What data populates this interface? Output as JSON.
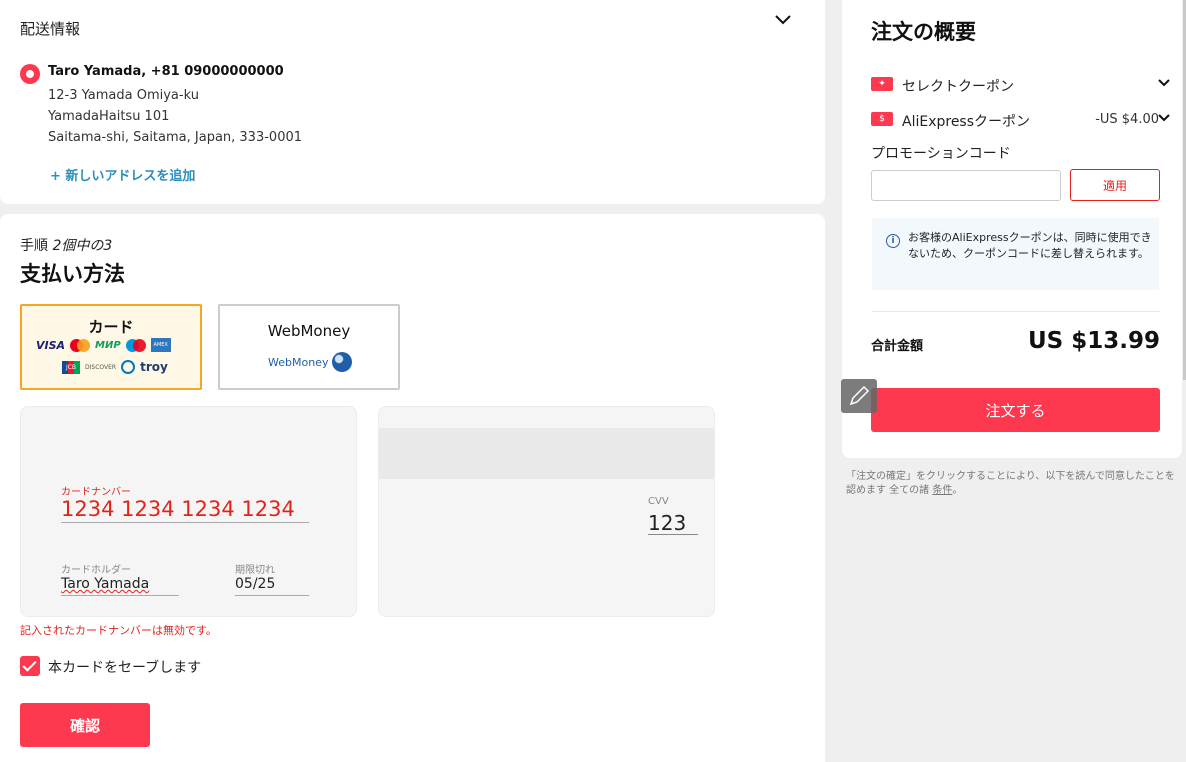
{
  "shipping": {
    "title": "配送情報",
    "name_phone": "Taro Yamada, +81 09000000000",
    "address": [
      "12-3 Yamada Omiya-ku",
      "YamadaHaitsu 101",
      "Saitama-shi, Saitama, Japan, 333-0001"
    ],
    "add_address": "+ 新しいアドレスを追加"
  },
  "payment": {
    "step_prefix": "手順",
    "step_mid": "2個中の",
    "step_num": "3",
    "title": "支払い方法",
    "methods": [
      {
        "label": "カード",
        "selected": true,
        "logos": [
          "VISA",
          "mastercard",
          "МИР",
          "maestro",
          "AMEX",
          "JCB",
          "DISCOVER",
          "Diners",
          "troy"
        ]
      },
      {
        "label": "WebMoney",
        "selected": false,
        "logo_text": "WebMoney"
      }
    ],
    "card": {
      "number_label": "カードナンバー",
      "number_value": "1234 1234 1234 1234",
      "holder_label": "カードホルダー",
      "holder_value": "Taro Yamada",
      "expiry_label": "期限切れ",
      "expiry_value": "05/25",
      "cvv_label": "CVV",
      "cvv_value": "123"
    },
    "error": "記入されたカードナンバーは無効です。",
    "save_card_label": "本カードをセーブします",
    "save_card_checked": true,
    "confirm_label": "確認"
  },
  "summary": {
    "title": "注文の概要",
    "select_coupon": "セレクトクーポン",
    "ali_coupon": "AliExpressクーポン",
    "ali_coupon_amount": "-US $4.00",
    "promo_label": "プロモーションコード",
    "promo_placeholder": "",
    "apply_label": "適用",
    "info": "お客様のAliExpressクーポンは、同時に使用できないため、クーポンコードに差し替えられます。",
    "total_label": "合計金額",
    "total_value": "US $13.99",
    "order_label": "注文する"
  },
  "terms": {
    "line1": "「注文の確定」をクリックすることにより、以下を読んで同意したことを",
    "line2_prefix": "認めます 全ての諸",
    "link": "条件",
    "line2_suffix": "。"
  },
  "colors": {
    "accent": "#fd384f",
    "error": "#e2231a",
    "link": "#2a8fbd",
    "selected_border": "#f5a623"
  }
}
